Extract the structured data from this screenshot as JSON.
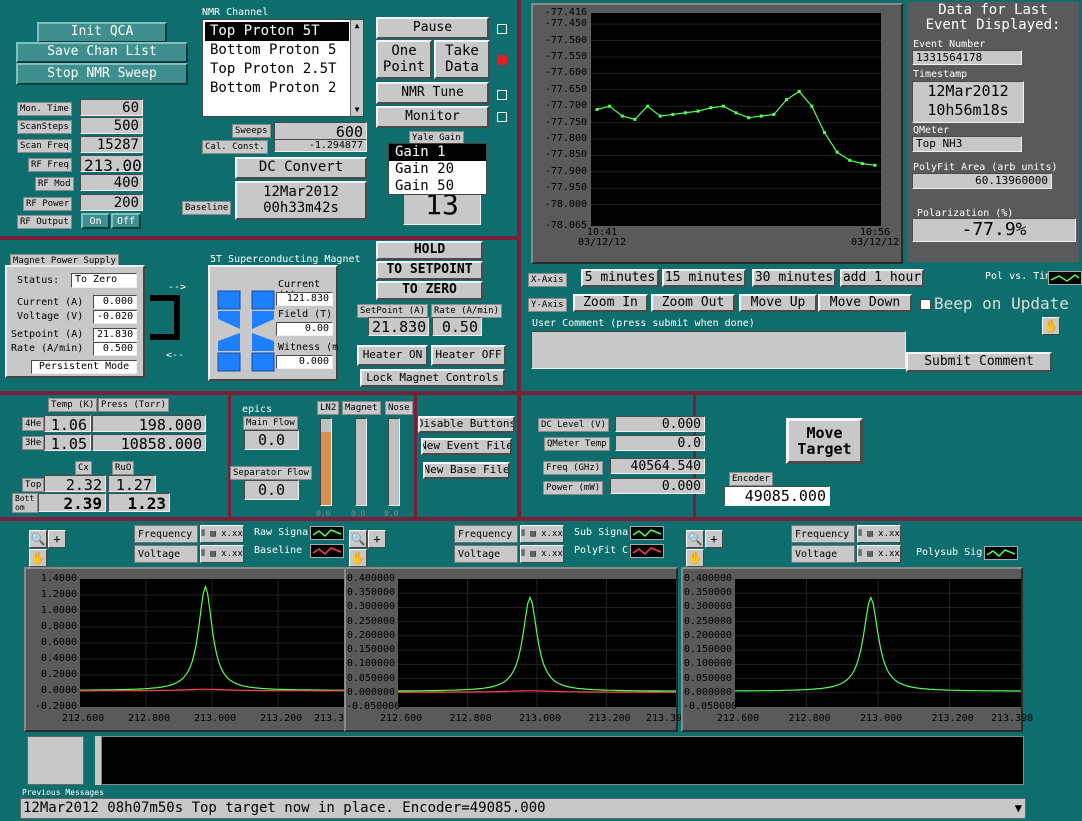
{
  "qca": {
    "init": "Init QCA",
    "save_chan": "Save Chan List",
    "stop_sweep": "Stop NMR Sweep"
  },
  "params": [
    {
      "label": "Mon. Time",
      "value": "60"
    },
    {
      "label": "ScanSteps",
      "value": "500"
    },
    {
      "label": "Scan Freq",
      "value": "15287"
    },
    {
      "label": "RF Freq",
      "value": "213.000"
    },
    {
      "label": "RF Mod",
      "value": "400"
    },
    {
      "label": "RF Power",
      "value": "200"
    }
  ],
  "rf_output": {
    "label": "RF Output",
    "on": "On",
    "off": "Off"
  },
  "nmr": {
    "title": "NMR Channel",
    "channels": [
      "Top Proton 5T",
      "Bottom Proton 5",
      "Top Proton 2.5T",
      "Bottom Proton 2"
    ],
    "selected": 0,
    "sweeps_label": "Sweeps",
    "sweeps": "600",
    "cal_label": "Cal. Const.",
    "cal": "-1.294877",
    "dc_convert": "DC Convert",
    "baseline_label": "Baseline",
    "baseline_date": "12Mar2012",
    "baseline_time": "00h33m42s"
  },
  "controls": {
    "pause": "Pause",
    "one_point": [
      "One",
      "Point"
    ],
    "take_data": [
      "Take",
      "Data"
    ],
    "nmr_tune": "NMR Tune",
    "monitor": "Monitor"
  },
  "yale": {
    "label": "Yale Gain",
    "options": [
      "Gain 1",
      "Gain 20",
      "Gain 50"
    ],
    "selected": 0,
    "counter": "13"
  },
  "trend": {
    "yticks": [
      "-77.416",
      "-77.450",
      "-77.500",
      "-77.550",
      "-77.600",
      "-77.650",
      "-77.700",
      "-77.750",
      "-77.800",
      "-77.850",
      "-77.900",
      "-77.950",
      "-78.000",
      "-78.065"
    ],
    "x_start": [
      "10:41",
      "03/12/12"
    ],
    "x_end": [
      "10:56",
      "03/12/12"
    ],
    "ymin": -78.065,
    "ymax": -77.416,
    "values": [
      -77.71,
      -77.7,
      -77.73,
      -77.74,
      -77.7,
      -77.73,
      -77.725,
      -77.72,
      -77.715,
      -77.705,
      -77.7,
      -77.72,
      -77.735,
      -77.73,
      -77.725,
      -77.68,
      -77.655,
      -77.7,
      -77.78,
      -77.84,
      -77.865,
      -77.875,
      -77.88
    ]
  },
  "last_event": {
    "title": [
      "Data for Last",
      "Event Displayed:"
    ],
    "event_label": "Event Number",
    "event": "1331564178",
    "ts_label": "Timestamp",
    "ts_date": "12Mar2012",
    "ts_time": "10h56m18s",
    "qmeter_label": "QMeter",
    "qmeter": "Top NH3",
    "area_label": "PolyFit Area (arb units)",
    "area": "60.13960000",
    "pol_label": "Polarization (%)",
    "pol": "-77.9%"
  },
  "axes_ctl": {
    "x_label": "X-Axis",
    "x_btns": [
      "5 minutes",
      "15 minutes",
      "30 minutes",
      "add 1 hour"
    ],
    "y_label": "Y-Axis",
    "y_btns": [
      "Zoom In",
      "Zoom Out",
      "Move Up",
      "Move Down"
    ],
    "beep": "Beep on Update",
    "pol_vs": "Pol vs. Tim"
  },
  "comment": {
    "label": "User Comment (press submit when done)",
    "submit": "Submit Comment"
  },
  "magnet_ps": {
    "title": "Magnet Power Supply",
    "status_label": "Status:",
    "status": "To Zero",
    "current_label": "Current (A)",
    "current": "0.000",
    "voltage_label": "Voltage (V)",
    "voltage": "-0.020",
    "setpoint_label": "Setpoint (A)",
    "setpoint": "21.830",
    "rate_label": "Rate (A/min)",
    "rate": "0.500",
    "persistent": "Persistent Mode"
  },
  "sc_magnet": {
    "title": "5T Superconducting Magnet",
    "current_label": "Current (A)",
    "current": "121.830",
    "field_label": "Field (T)",
    "field": "0.00",
    "witness_label": "Witness (mT",
    "witness": "0.000"
  },
  "magnet_ctl": {
    "hold": "HOLD",
    "to_setpoint": "TO SETPOINT",
    "to_zero": "TO ZERO",
    "sp_label": "SetPoint (A)",
    "rate_label": "Rate (A/min)",
    "sp": "21.830",
    "rate": "0.50",
    "heater_on": "Heater ON",
    "heater_off": "Heater OFF",
    "lock": "Lock Magnet Controls"
  },
  "cryo": {
    "temp_label": "Temp (K)",
    "press_label": "Press (Torr)",
    "he4_label": "4He",
    "he4_temp": "1.06",
    "he4_press": "198.000",
    "he3_label": "3He",
    "he3_temp": "1.05",
    "he3_press": "10858.000",
    "cx_label": "Cx",
    "ruo_label": "RuO",
    "top_label": "Top",
    "top_cx": "2.32",
    "top_ruo": "1.27",
    "bot_label": "Bott om",
    "bot_cx": "2.39",
    "bot_ruo": "1.23"
  },
  "epics": {
    "title": "epics",
    "main_flow_label": "Main Flow",
    "main_flow": "0.0",
    "sep_flow_label": "Separator Flow",
    "sep_flow": "0.0",
    "bars": [
      {
        "label": "LN2",
        "value": 0.85
      },
      {
        "label": "Magnet",
        "value": 0.0
      },
      {
        "label": "Nose",
        "value": 0.0
      }
    ]
  },
  "file_btns": {
    "disable": "Disable Buttons",
    "new_event": "New Event File",
    "new_base": "New Base File"
  },
  "qmeter": {
    "dc_label": "DC Level (V)",
    "dc": "0.000",
    "temp_label": "QMeter Temp",
    "temp": "0.0",
    "freq_label": "Freq (GHz)",
    "freq": "40564.540",
    "power_label": "Power (mW)",
    "power": "0.000"
  },
  "target": {
    "move": [
      "Move",
      "Target"
    ],
    "encoder_label": "Encoder",
    "encoder": "49085.000"
  },
  "spectra": [
    {
      "axis_tags": [
        "Frequency",
        "Voltage"
      ],
      "legends": [
        "Raw Signa",
        "Baseline"
      ],
      "yticks": [
        "1.4000",
        "1.2000",
        "1.0000",
        "0.8000",
        "0.6000",
        "0.4000",
        "0.2000",
        "0.0000",
        "-0.2000"
      ],
      "ymin": -0.2,
      "ymax": 1.4,
      "peak": 1.3,
      "red": true
    },
    {
      "axis_tags": [
        "Frequency",
        "Voltage"
      ],
      "legends": [
        "Sub Signal",
        "PolyFit Cur"
      ],
      "yticks": [
        "0.400000",
        "0.350000",
        "0.300000",
        "0.250000",
        "0.200000",
        "0.150000",
        "0.100000",
        "0.050000",
        "0.000000",
        "-0.050000"
      ],
      "ymin": -0.05,
      "ymax": 0.4,
      "peak": 0.33,
      "red": true
    },
    {
      "axis_tags": [
        "Frequency",
        "Voltage"
      ],
      "legends": [
        "Polysub Sig"
      ],
      "yticks": [
        "0.400000",
        "0.350000",
        "0.300000",
        "0.250000",
        "0.200000",
        "0.150000",
        "0.100000",
        "0.050000",
        "0.000000",
        "-0.050000"
      ],
      "ymin": -0.05,
      "ymax": 0.4,
      "peak": 0.33,
      "red": false
    }
  ],
  "spectra_xticks": [
    "212.600",
    "212.800",
    "213.000",
    "213.200",
    "213.398"
  ],
  "bar_labels": [
    "0.0",
    "0.0",
    "0.0"
  ],
  "messages": {
    "label": "Previous Messages",
    "last": "12Mar2012 08h07m50s Top target now in place.  Encoder=49085.000"
  }
}
